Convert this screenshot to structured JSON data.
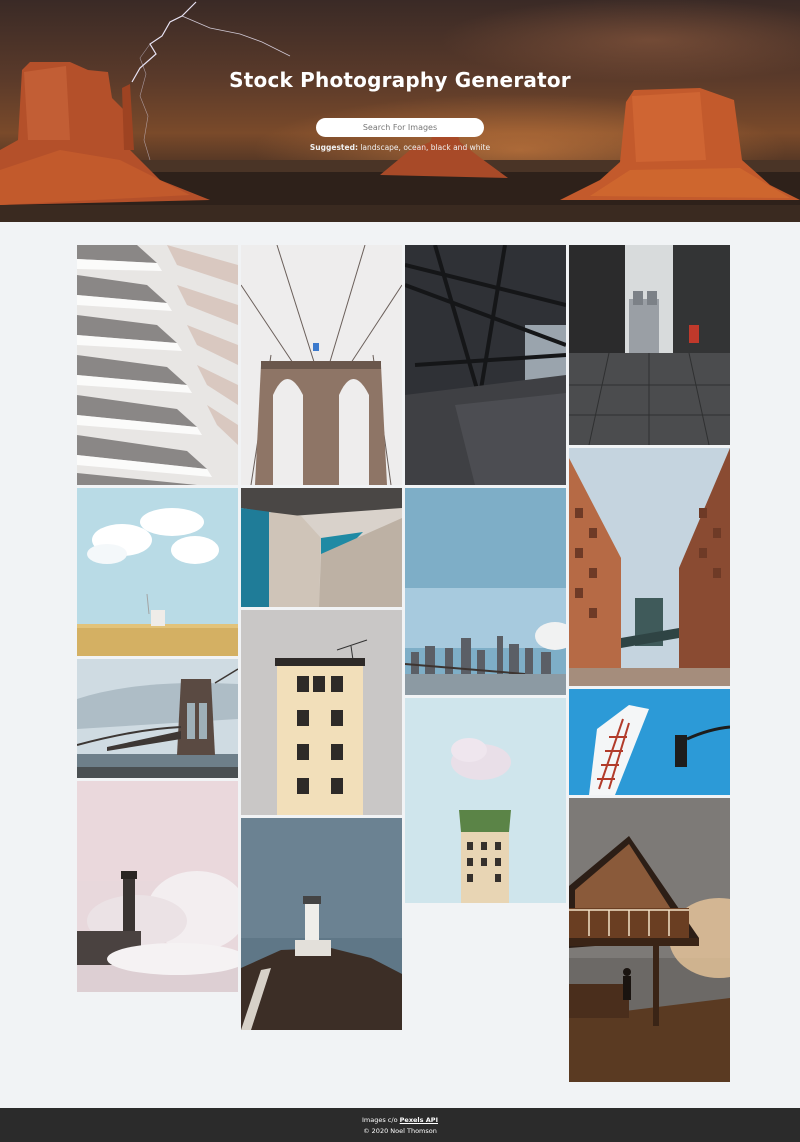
{
  "hero": {
    "title": "Stock Photography Generator",
    "search_placeholder": "Search For Images",
    "suggested_label": "Suggested:",
    "suggestions": [
      "landscape",
      "ocean",
      "black and white"
    ]
  },
  "gallery": {
    "images": [
      {
        "subject": "white balcony facade"
      },
      {
        "subject": "brooklyn bridge cables"
      },
      {
        "subject": "steel bridge underside"
      },
      {
        "subject": "tower bridge street"
      },
      {
        "subject": "field with clouds"
      },
      {
        "subject": "concrete building corner"
      },
      {
        "subject": "city skyline"
      },
      {
        "subject": "manhattan bridge between buildings"
      },
      {
        "subject": "brooklyn bridge tower"
      },
      {
        "subject": "apartment building facade"
      },
      {
        "subject": "building with green roof"
      },
      {
        "subject": "fire escape and traffic light"
      },
      {
        "subject": "lighthouse and waves"
      },
      {
        "subject": "lighthouse on cliff"
      },
      {
        "subject": "cabin at sunset"
      }
    ]
  },
  "footer": {
    "credit_prefix": "Images c/o",
    "credit_link": "Pexels API",
    "copyright": "© 2020 Noel Thomson"
  },
  "colors": {
    "background": "#f1f3f5",
    "footer": "#2b2b2b",
    "hero_accent": "#d8743a"
  }
}
